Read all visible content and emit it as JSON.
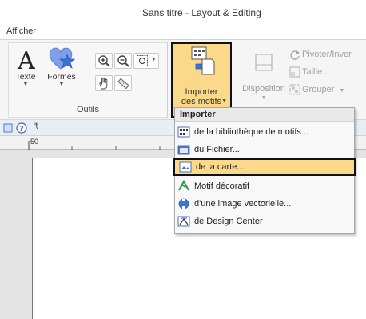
{
  "window": {
    "title": "Sans titre - Layout & Editing"
  },
  "tabs": {
    "active": "Afficher"
  },
  "ribbon": {
    "outils": {
      "label": "Outils",
      "texte_label": "Texte",
      "formes_label": "Formes"
    },
    "importer": {
      "line1": "Importer",
      "line2": "des motifs"
    },
    "disposition": {
      "label": "Disposition"
    },
    "pivoter": "Pivoter/Inver",
    "taille": "Taille...",
    "grouper": "Grouper"
  },
  "ruler": {
    "marker": "50"
  },
  "menu": {
    "header": "Importer",
    "items": [
      {
        "label": "de la bibliothèque de motifs...",
        "icon": "library-icon"
      },
      {
        "label": "du Fichier...",
        "icon": "folder-icon"
      },
      {
        "label": "de la carte...",
        "icon": "card-icon",
        "selected": true
      },
      {
        "label": "Motif décoratif",
        "icon": "decorative-motif-icon"
      },
      {
        "label": "d'une image vectorielle...",
        "icon": "vector-image-icon"
      },
      {
        "label": "de Design Center",
        "icon": "design-center-icon"
      }
    ]
  },
  "colors": {
    "highlight": "#fbd98a",
    "accent_blue": "#5b7fd6",
    "heart": "#7fa0e8"
  }
}
